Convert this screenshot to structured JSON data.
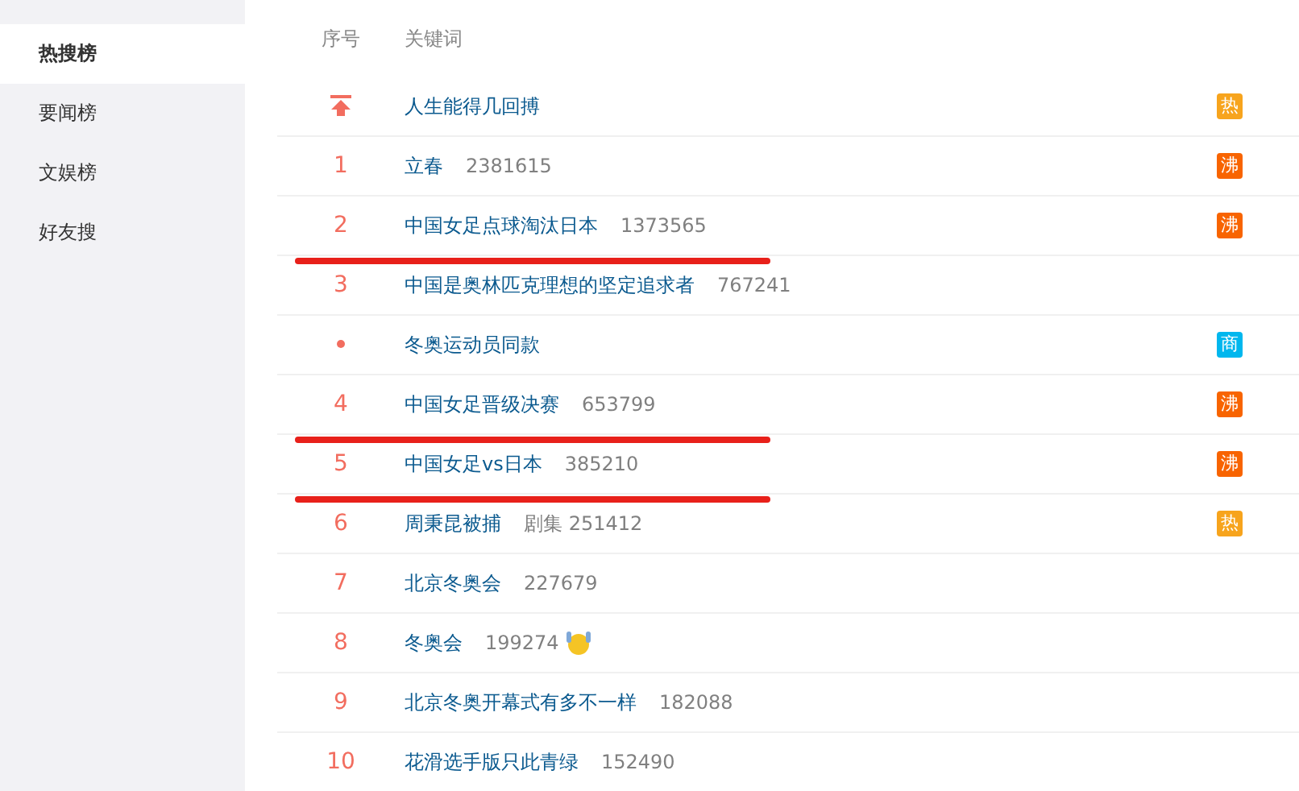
{
  "sidebar": {
    "items": [
      {
        "label": "热搜榜",
        "selected": true
      },
      {
        "label": "要闻榜",
        "selected": false
      },
      {
        "label": "文娱榜",
        "selected": false
      },
      {
        "label": "好友搜",
        "selected": false
      }
    ]
  },
  "table": {
    "columns": [
      "序号",
      "关键词"
    ],
    "rows": [
      {
        "kind": "pin",
        "keyword": "人生能得几回搏",
        "tag": {
          "label": "热",
          "color": "#f7a41d"
        }
      },
      {
        "kind": "number",
        "rank": "1",
        "keyword": "立春",
        "count": "2381615",
        "tag": {
          "label": "沸",
          "color": "#f86400"
        }
      },
      {
        "kind": "number",
        "rank": "2",
        "keyword": "中国女足点球淘汰日本",
        "count": "1373565",
        "tag": {
          "label": "沸",
          "color": "#f86400"
        },
        "underlined": true
      },
      {
        "kind": "number",
        "rank": "3",
        "keyword": "中国是奥林匹克理想的坚定追求者",
        "count": "767241"
      },
      {
        "kind": "dot",
        "keyword": "冬奥运动员同款",
        "tag": {
          "label": "商",
          "color": "#00b7ee"
        }
      },
      {
        "kind": "number",
        "rank": "4",
        "keyword": "中国女足晋级决赛",
        "count": "653799",
        "tag": {
          "label": "沸",
          "color": "#f86400"
        },
        "underlined": true
      },
      {
        "kind": "number",
        "rank": "5",
        "keyword": "中国女足vs日本",
        "count": "385210",
        "tag": {
          "label": "沸",
          "color": "#f86400"
        },
        "underlined": true
      },
      {
        "kind": "number",
        "rank": "6",
        "keyword": "周秉昆被捕",
        "count": "剧集 251412",
        "tag": {
          "label": "热",
          "color": "#f7a41d"
        }
      },
      {
        "kind": "number",
        "rank": "7",
        "keyword": "北京冬奥会",
        "count": "227679"
      },
      {
        "kind": "number",
        "rank": "8",
        "keyword": "冬奥会",
        "count": "199274",
        "emoji": true
      },
      {
        "kind": "number",
        "rank": "9",
        "keyword": "北京冬奥开幕式有多不一样",
        "count": "182088"
      },
      {
        "kind": "number",
        "rank": "10",
        "keyword": "花滑选手版只此青绿",
        "count": "152490"
      }
    ]
  }
}
